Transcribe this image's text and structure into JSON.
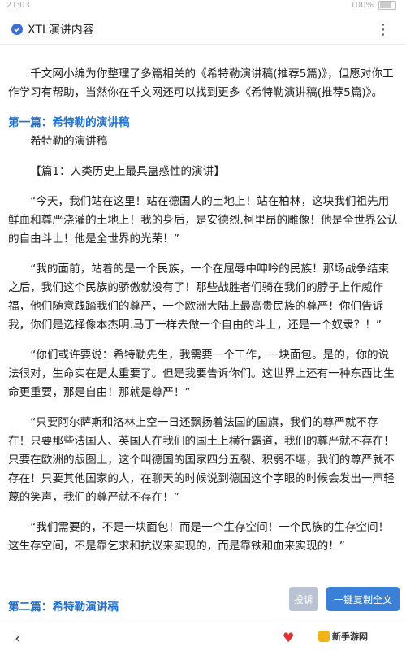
{
  "status": {
    "time": "21:03",
    "battery": "100%"
  },
  "header": {
    "title": "XTL演讲内容",
    "more": "⋮"
  },
  "intro": "千文网小编为你整理了多篇相关的《希特勒演讲稿(推荐5篇)》，但愿对你工作学习有帮助，当然你在千文网还可以找到更多《希特勒演讲稿(推荐5篇)》。",
  "section1": {
    "heading": "第一篇：希特勒的演讲稿",
    "subtitle": "希特勒的演讲稿",
    "lead": "【篇1：人类历史上最具蛊惑性的演讲】",
    "paragraphs": [
      "“今天，我们站在这里！站在德国人的土地上！站在柏林，这块我们祖先用鲜血和尊严浇灌的土地上！我的身后，是安德烈.柯里昂的雕像！他是全世界公认的自由斗士！他是全世界的光荣！”",
      "“我的面前，站着的是一个民族，一个在屈辱中呻吟的民族！那场战争结束之后，我们这个民族的骄傲就没有了！那些战胜者们骑在我们的脖子上作威作福，他们随意践踏我们的尊严，一个欧洲大陆上最高贵民族的尊严！你们告诉我，你们是选择像本杰明.马丁一样去做一个自由的斗士，还是一个奴隶？！”",
      "“你们或许要说：希特勒先生，我需要一个工作，一块面包。是的，你的说法很对，生命实在是太重要了。但是我要告诉你们。这世界上还有一种东西比生命更重要，那是自由！那就是尊严！”",
      "“只要阿尔萨斯和洛林上空一日还飘扬着法国的国旗，我们的尊严就不存在！只要那些法国人、英国人在我们的国土上横行霸道，我们的尊严就不存在！只要在欧洲的版图上，这个叫德国的国家四分五裂、积弱不堪，我们的尊严就不存在！只要其他国家的人，在聊天的时候说到德国这个字眼的时候会发出一声轻蔑的笑声，我们的尊严就不存在！”",
      "“我们需要的，不是一块面包！而是一个生存空间！一个民族的生存空间！这生存空间，不是靠乞求和抗议来实现的，而是靠铁和血来实现的！”"
    ]
  },
  "section2": {
    "heading": "第二篇：希特勒演讲稿"
  },
  "actions": {
    "report": "投诉",
    "copy": "一键复制全文"
  },
  "nav": {
    "back": "‹",
    "logo_text": "新手游网"
  }
}
